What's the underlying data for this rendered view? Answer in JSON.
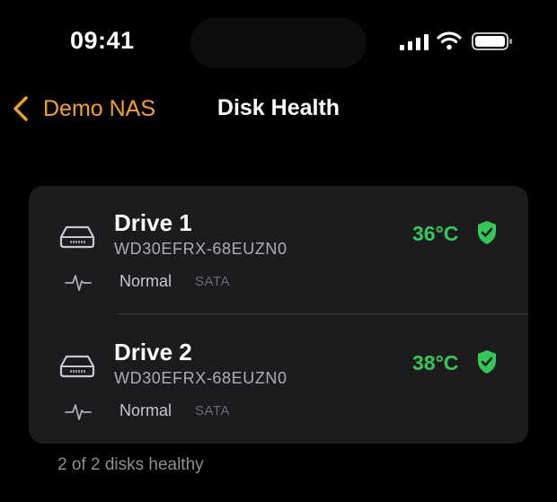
{
  "status_bar": {
    "time": "09:41",
    "icons": [
      "cellular-signal-icon",
      "wifi-icon",
      "battery-icon"
    ]
  },
  "nav": {
    "back_label": "Demo NAS",
    "title": "Disk Health"
  },
  "drives": [
    {
      "name": "Drive 1",
      "model": "WD30EFRX-68EUZN0",
      "status": "Normal",
      "bus": "SATA",
      "temperature": "36°C",
      "health_icon": "shield-check-icon"
    },
    {
      "name": "Drive 2",
      "model": "WD30EFRX-68EUZN0",
      "status": "Normal",
      "bus": "SATA",
      "temperature": "38°C",
      "health_icon": "shield-check-icon"
    }
  ],
  "footer": {
    "summary": "2 of 2 disks healthy"
  },
  "colors": {
    "accent": "#f0a035",
    "healthy": "#34c759",
    "card_background": "#1c1c1e",
    "background": "#000000"
  }
}
